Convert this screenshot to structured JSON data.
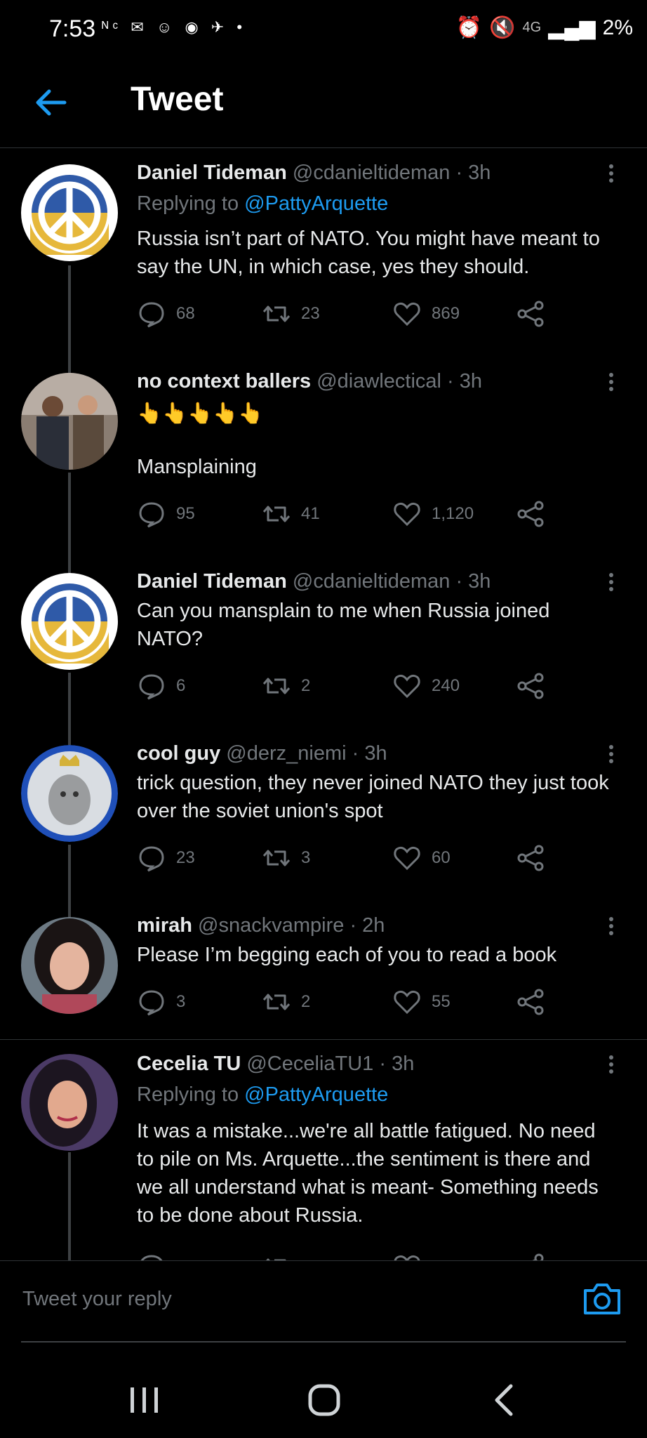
{
  "status_bar": {
    "time": "7:53",
    "left_icons": [
      "nc-icon",
      "teams-icon",
      "mail-icon",
      "app-icon",
      "shield-icon",
      "signal-icon",
      "dot-icon"
    ],
    "network": "4G",
    "battery": "2%"
  },
  "header": {
    "title": "Tweet"
  },
  "tweets": [
    {
      "name": "Daniel Tideman",
      "handle": "@cdanieltideman",
      "time": "· 3h",
      "replying_prefix": "Replying to ",
      "replying_to": "@PattyArquette",
      "text": "Russia isn’t part of NATO. You might have meant to say the UN, in which case, yes they should.",
      "replies": "68",
      "retweets": "23",
      "likes": "869"
    },
    {
      "name": "no context ballers",
      "handle": "@diawlectical",
      "time": "· 3h",
      "emoji": "👆👆👆👆👆",
      "text": "Mansplaining",
      "replies": "95",
      "retweets": "41",
      "likes": "1,120"
    },
    {
      "name": "Daniel Tideman",
      "handle": "@cdanieltideman",
      "time": "· 3h",
      "text": "Can you mansplain to me when Russia joined NATO?",
      "replies": "6",
      "retweets": "2",
      "likes": "240"
    },
    {
      "name": "cool guy",
      "handle": "@derz_niemi",
      "time": "· 3h",
      "text": "trick question, they never joined NATO they just took over the soviet union's spot",
      "replies": "23",
      "retweets": "3",
      "likes": "60"
    },
    {
      "name": "mirah",
      "handle": "@snackvampire",
      "time": "· 2h",
      "text": "Please I’m begging each of you to read a book",
      "replies": "3",
      "retweets": "2",
      "likes": "55"
    },
    {
      "name": "Cecelia TU",
      "handle": "@CeceliaTU1",
      "time": "· 3h",
      "replying_prefix": "Replying to ",
      "replying_to": "@PattyArquette",
      "text": "It was a mistake...we're all battle fatigued. No need to pile on Ms. Arquette...the sentiment is there and we all understand what is meant- Something needs to be done about Russia."
    }
  ],
  "reply_bar": {
    "placeholder": "Tweet your reply"
  },
  "colors": {
    "accent": "#1d9bf0",
    "background": "#000000",
    "muted": "#71767b",
    "text": "#e7e9ea"
  }
}
